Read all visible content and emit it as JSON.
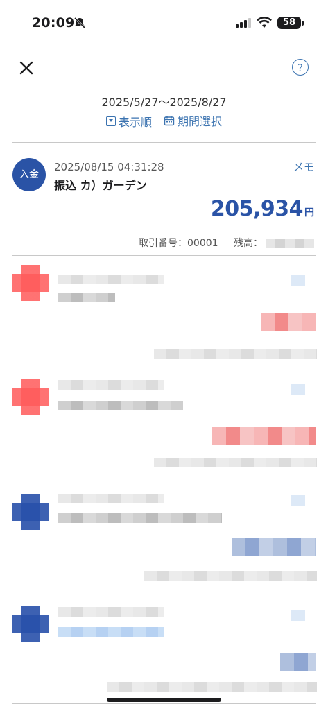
{
  "status_bar": {
    "time": "20:09",
    "battery": "58"
  },
  "header": {
    "period": "2025/5/27〜2025/8/27",
    "sort_label": "表示順",
    "period_select_label": "期間選択"
  },
  "transaction": {
    "badge": "入金",
    "datetime": "2025/08/15 04:31:28",
    "description": "振込 カ）ガーデン",
    "memo_label": "メモ",
    "amount": "205,934",
    "currency": "円",
    "ref_label": "取引番号：00001",
    "balance_label": "残高："
  }
}
